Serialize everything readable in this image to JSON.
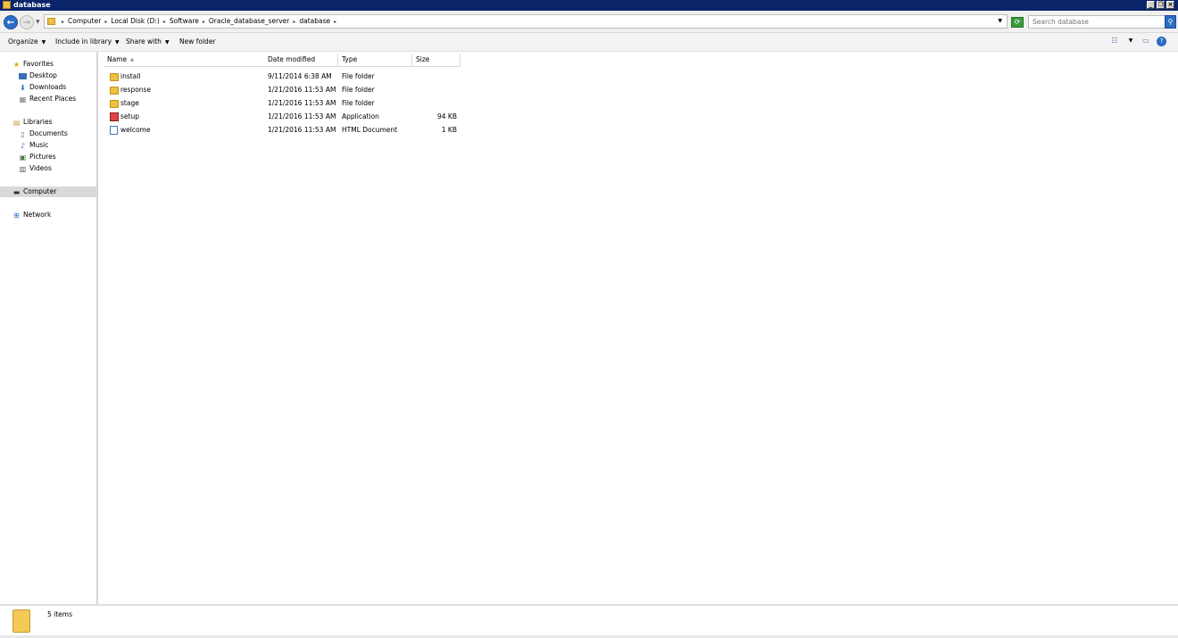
{
  "window": {
    "title": "database"
  },
  "address": {
    "crumbs": [
      "Computer",
      "Local Disk (D:)",
      "Software",
      "Oracle_database_server",
      "database"
    ]
  },
  "search": {
    "placeholder": "Search database"
  },
  "toolbar": {
    "organize": "Organize",
    "include": "Include in library",
    "share": "Share with",
    "new_folder": "New folder"
  },
  "sidebar": {
    "favorites": "Favorites",
    "desktop": "Desktop",
    "downloads": "Downloads",
    "recent": "Recent Places",
    "libraries": "Libraries",
    "documents": "Documents",
    "music": "Music",
    "pictures": "Pictures",
    "videos": "Videos",
    "computer": "Computer",
    "network": "Network"
  },
  "columns": {
    "name": "Name",
    "date": "Date modified",
    "type": "Type",
    "size": "Size"
  },
  "files": [
    {
      "name": "install",
      "date": "9/11/2014 6:38 AM",
      "type": "File folder",
      "size": "",
      "icon": "folder-icon"
    },
    {
      "name": "response",
      "date": "1/21/2016 11:53 AM",
      "type": "File folder",
      "size": "",
      "icon": "folder-icon"
    },
    {
      "name": "stage",
      "date": "1/21/2016 11:53 AM",
      "type": "File folder",
      "size": "",
      "icon": "folder-icon"
    },
    {
      "name": "setup",
      "date": "1/21/2016 11:53 AM",
      "type": "Application",
      "size": "94 KB",
      "icon": "application-icon"
    },
    {
      "name": "welcome",
      "date": "1/21/2016 11:53 AM",
      "type": "HTML Document",
      "size": "1 KB",
      "icon": "html-document-icon"
    }
  ],
  "status": {
    "count": "5 items"
  }
}
